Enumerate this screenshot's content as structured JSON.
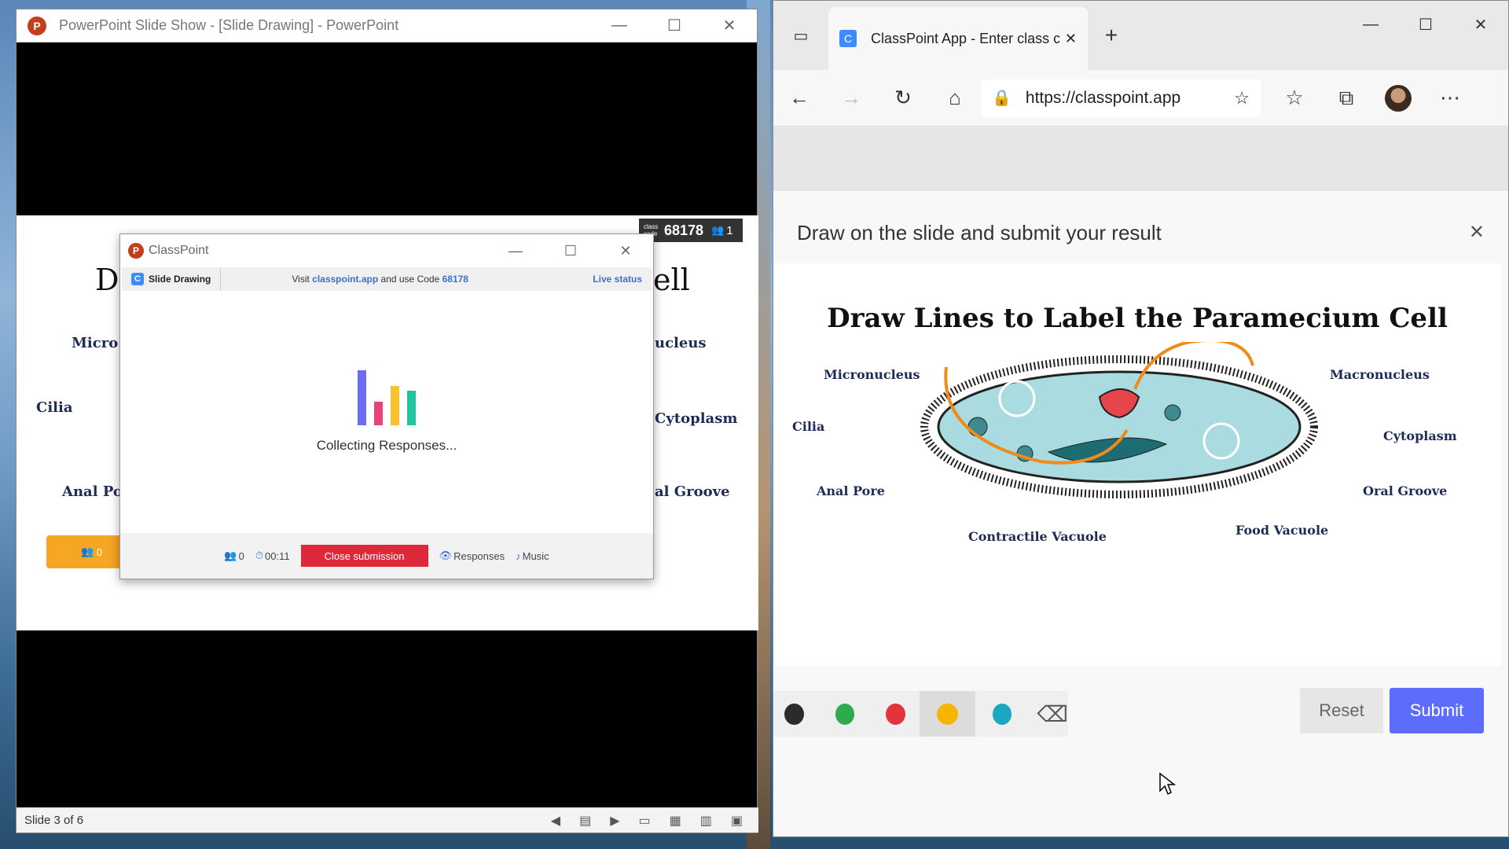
{
  "ppt": {
    "window_title": "PowerPoint Slide Show - [Slide Drawing] - PowerPoint",
    "logo_letter": "P",
    "minimize": "—",
    "maximize": "☐",
    "close": "✕",
    "slide_title_left": "D",
    "slide_title_right": "ell",
    "labels": {
      "micro": "Micro",
      "nucleus": "ucleus",
      "cilia": "Cilia",
      "cytoplasm": "Cytoplasm",
      "anal": "Anal Po",
      "oral": "al Groove"
    },
    "class_code_small": "class code",
    "class_code": "68178",
    "participants": "1",
    "orange_count": "0",
    "status": "Slide 3 of 6"
  },
  "classpoint": {
    "title": "ClassPoint",
    "tab": "Slide Drawing",
    "visit_prefix": "Visit",
    "visit_site": "classpoint.app",
    "visit_middle": "and use Code",
    "visit_code": "68178",
    "live_status": "Live status",
    "collecting": "Collecting Responses...",
    "count": "0",
    "timer": "00:11",
    "close_submission": "Close submission",
    "responses": "Responses",
    "music": "Music",
    "bar_colors": [
      "#6a6cf5",
      "#e8437a",
      "#f7c12f",
      "#21c4a0"
    ]
  },
  "browser": {
    "tab_title": "ClassPoint App - Enter class code",
    "url": "https://classpoint.app",
    "modal_title": "Draw on the slide and submit your result",
    "modal_close": "✕",
    "slide_title": "Draw Lines to Label the Paramecium Cell",
    "labels": {
      "micronucleus": "Micronucleus",
      "macronucleus": "Macronucleus",
      "cilia": "Cilia",
      "cytoplasm": "Cytoplasm",
      "anal_pore": "Anal Pore",
      "oral_groove": "Oral Groove",
      "contractile_vacuole": "Contractile Vacuole",
      "food_vacuole": "Food Vacuole"
    },
    "colors": [
      "#2b2b2b",
      "#2eab4e",
      "#e2333f",
      "#f7b500",
      "#1ba6c2"
    ],
    "reset": "Reset",
    "submit": "Submit"
  }
}
